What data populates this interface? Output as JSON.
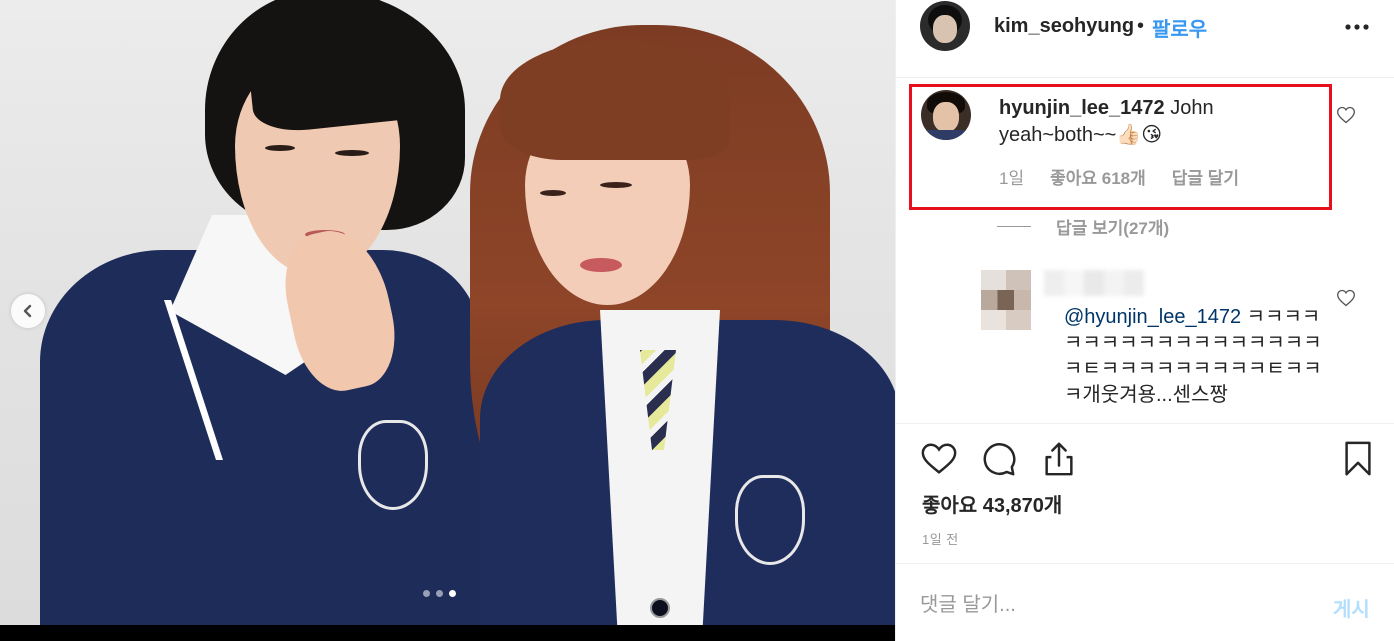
{
  "post": {
    "owner": {
      "username": "kim_seohyung",
      "separator": "•",
      "follow_label": "팔로우"
    },
    "carousel": {
      "total": 3,
      "active_index": 2
    }
  },
  "comments": [
    {
      "username": "hyunjin_lee_1472",
      "text": " John yeah~both~~👍🏻😘",
      "time": "1일",
      "likes": "좋아요 618개",
      "reply_label": "답글 달기",
      "view_replies": "답글 보기(27개)"
    },
    {
      "mention": "@hyunjin_lee_1472",
      "text": " ㅋㅋㅋㅋㅋㅋㅋㅋㅋㅋㅋㅋㅋㅋㅋㅋㅋㅋㅋㅌㅋㅋㅋㅋㅋㅋㅋㅋㅋㅌㅋㅋㅋ개웃겨용...센스짱"
    }
  ],
  "actions": {
    "likes_line": "좋아요 43,870개",
    "posted": "1일 전"
  },
  "add_comment": {
    "placeholder": "댓글 달기...",
    "post_label": "게시"
  },
  "colors": {
    "accent": "#3897f0",
    "highlight": "#e6101c",
    "muted": "#999999"
  },
  "icons": [
    "chevron-left-icon",
    "more-icon",
    "heart-outline-icon",
    "comment-icon",
    "share-icon",
    "bookmark-icon"
  ]
}
